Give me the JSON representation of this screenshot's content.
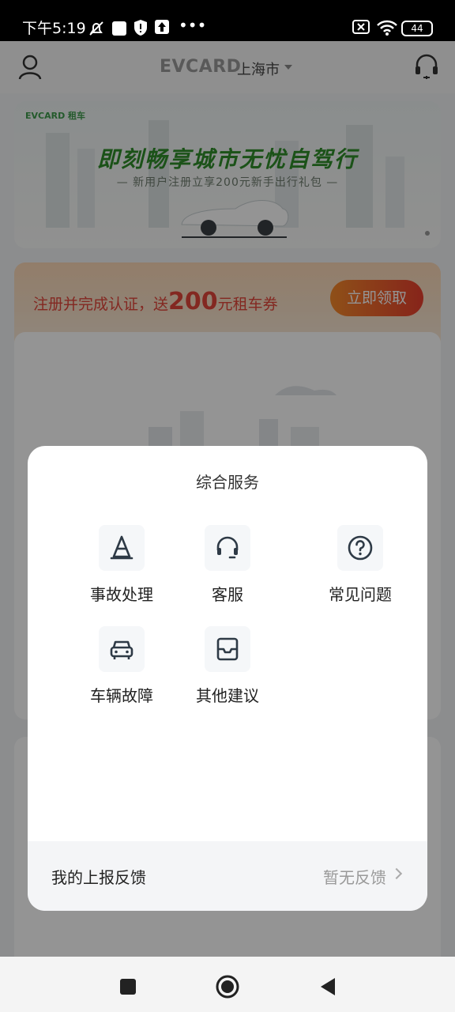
{
  "status_bar": {
    "time": "下午5:19",
    "battery": "44"
  },
  "header": {
    "brand": "EVCARD",
    "city": "上海市"
  },
  "banner": {
    "logo": "EVCARD 租车",
    "title": "即刻畅享城市无忧自驾行",
    "subtitle": "— 新用户注册立享200元新手出行礼包 —"
  },
  "promo": {
    "text_prefix": "注册并完成认证，送",
    "amount": "200",
    "text_suffix": "元租车券",
    "button": "立即领取"
  },
  "modal": {
    "title": "综合服务",
    "services": [
      {
        "label": "事故处理",
        "icon": "traffic-cone-icon"
      },
      {
        "label": "客服",
        "icon": "headset-icon"
      },
      {
        "label": "常见问题",
        "icon": "question-circle-icon"
      },
      {
        "label": "车辆故障",
        "icon": "car-icon"
      },
      {
        "label": "其他建议",
        "icon": "inbox-icon"
      }
    ],
    "footer": {
      "label": "我的上报反馈",
      "status": "暂无反馈"
    }
  }
}
